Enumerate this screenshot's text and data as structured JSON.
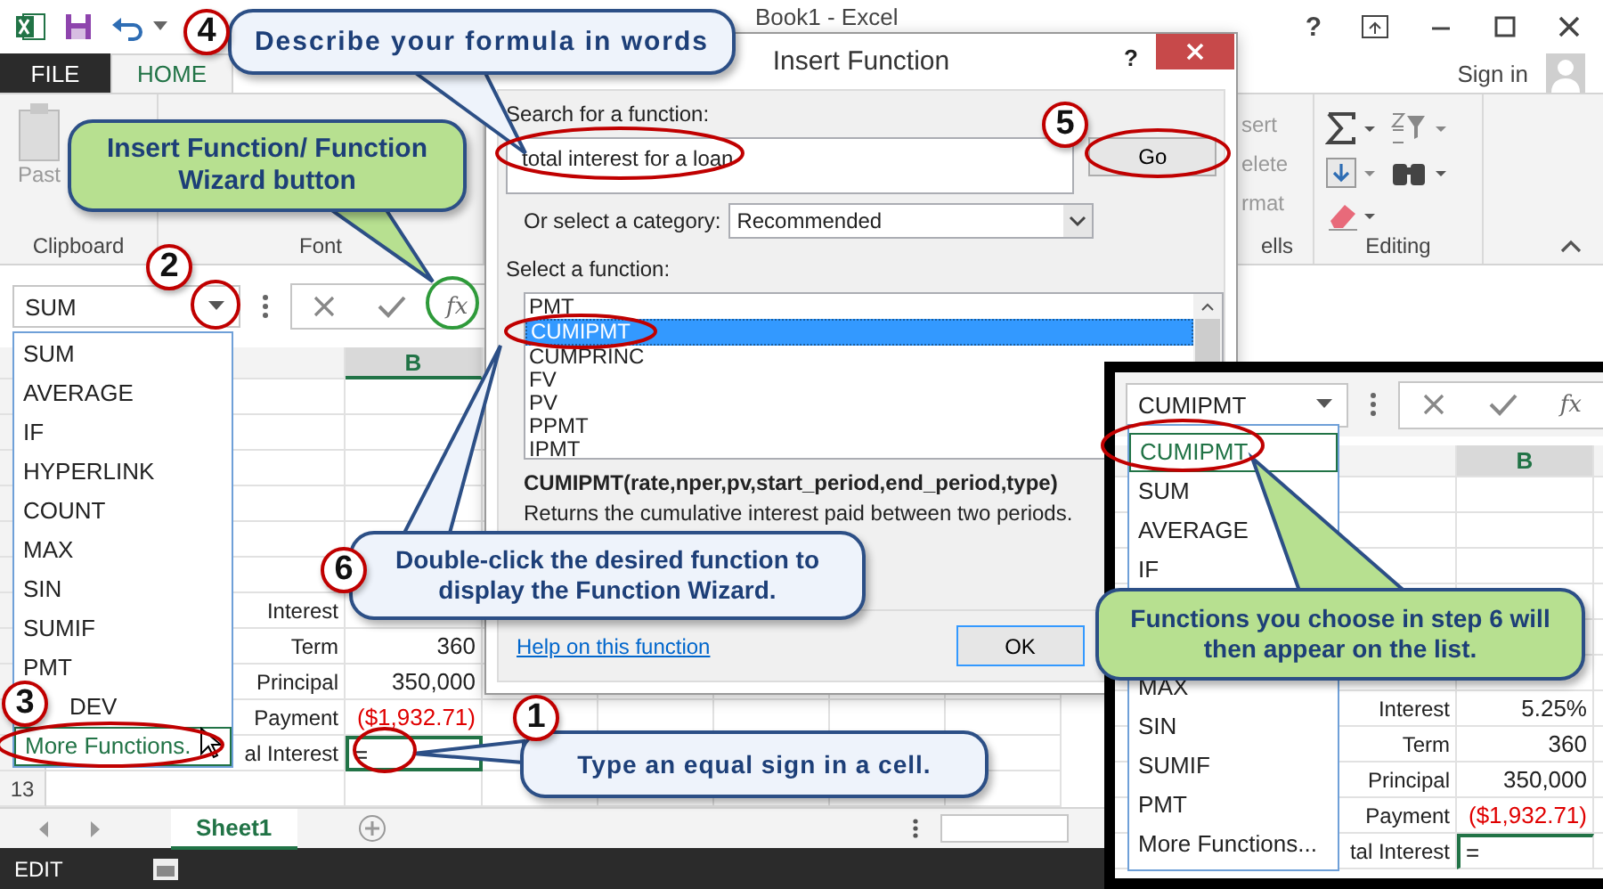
{
  "window": {
    "title": "Book1 - Excel",
    "help": "?",
    "sign_in": "Sign in"
  },
  "ribbon_tabs": [
    {
      "label": "FILE",
      "selected": false
    },
    {
      "label": "HOME",
      "selected": true
    }
  ],
  "ribbon": {
    "paste_label": "Past",
    "groups": [
      "Clipboard",
      "Font",
      "ells",
      "Editing"
    ],
    "cells_commands": [
      "sert",
      "elete",
      "rmat"
    ]
  },
  "name_box": "SUM",
  "formula_bar_fx": "fx",
  "function_dropdown": [
    {
      "label": "SUM",
      "selected": false,
      "covered": false
    },
    {
      "label": "AVERAGE",
      "selected": false,
      "covered": false
    },
    {
      "label": "IF",
      "selected": false,
      "covered": false
    },
    {
      "label": "HYPERLINK",
      "selected": false,
      "covered": false
    },
    {
      "label": "COUNT",
      "selected": false,
      "covered": false
    },
    {
      "label": "MAX",
      "selected": false,
      "covered": false
    },
    {
      "label": "SIN",
      "selected": false,
      "covered": false
    },
    {
      "label": "SUMIF",
      "selected": false,
      "covered": false
    },
    {
      "label": "PMT",
      "selected": false,
      "covered": false
    },
    {
      "label": "DEV",
      "selected": false,
      "covered": true
    },
    {
      "label": "More Functions.",
      "selected": true,
      "covered": false
    }
  ],
  "sheet": {
    "column_header": "B",
    "rows": [
      {
        "label": "Interest"
      },
      {
        "label": "Term",
        "value": "360",
        "negative": false,
        "active": false
      },
      {
        "label": "Principal",
        "value": "350,000",
        "negative": false,
        "active": false
      },
      {
        "label": "Payment",
        "value": "($1,932.71)",
        "negative": true,
        "active": false
      },
      {
        "label": "al Interest",
        "value": "=",
        "negative": false,
        "active": true
      }
    ],
    "row_number": "13"
  },
  "sheet_tabs": [
    {
      "label": "Sheet1",
      "selected": true
    }
  ],
  "status_bar": {
    "mode": "EDIT"
  },
  "dialog": {
    "title": "Insert Function",
    "help": "?",
    "search_label": "Search for a function:",
    "search_value": "total interest for a loan",
    "go": "Go",
    "category_label": "Or select a category:",
    "category": "Recommended",
    "select_label": "Select a function:",
    "functions": [
      {
        "name": "PMT",
        "selected": false
      },
      {
        "name": "CUMIPMT",
        "selected": true
      },
      {
        "name": "CUMPRINC",
        "selected": false
      },
      {
        "name": "FV",
        "selected": false
      },
      {
        "name": "PV",
        "selected": false
      },
      {
        "name": "PPMT",
        "selected": false
      },
      {
        "name": "IPMT",
        "selected": false
      }
    ],
    "signature": "CUMIPMT(rate,nper,pv,start_period,end_period,type)",
    "description": "Returns the cumulative interest paid between two periods.",
    "help_link": "Help on this function",
    "ok": "OK"
  },
  "inset": {
    "name_box": "CUMIPMT",
    "formula_bar_fx": "fx",
    "dropdown": [
      {
        "label": "CUMIPMT",
        "selected": true
      },
      {
        "label": "SUM",
        "selected": false
      },
      {
        "label": "AVERAGE",
        "selected": false
      },
      {
        "label": "IF",
        "selected": false
      },
      {
        "label": "MAX",
        "selected": false
      },
      {
        "label": "SIN",
        "selected": false
      },
      {
        "label": "SUMIF",
        "selected": false
      },
      {
        "label": "PMT",
        "selected": false
      },
      {
        "label": "More Functions...",
        "selected": false
      }
    ],
    "column_header": "B",
    "rows": [
      {
        "label": "Interest",
        "value": "5.25%",
        "negative": false,
        "active": false
      },
      {
        "label": "Term",
        "value": "360",
        "negative": false,
        "active": false
      },
      {
        "label": "Principal",
        "value": "350,000",
        "negative": false,
        "active": false
      },
      {
        "label": "Payment",
        "value": "($1,932.71)",
        "negative": true,
        "active": false
      },
      {
        "label": "tal Interest",
        "value": "=",
        "negative": false,
        "active": true
      }
    ]
  },
  "steps": [
    "1",
    "2",
    "3",
    "4",
    "5",
    "6"
  ],
  "callouts": [
    {
      "kind": "note",
      "text": "Describe your formula in words"
    },
    {
      "kind": "tip",
      "text": "Insert Function/ Function Wizard button"
    },
    {
      "kind": "note",
      "text": "Double-click the desired function to display the Function Wizard."
    },
    {
      "kind": "note",
      "text": "Type an equal sign in a cell."
    },
    {
      "kind": "tip",
      "text": "Functions you choose in step 6 will then appear on the list."
    }
  ]
}
